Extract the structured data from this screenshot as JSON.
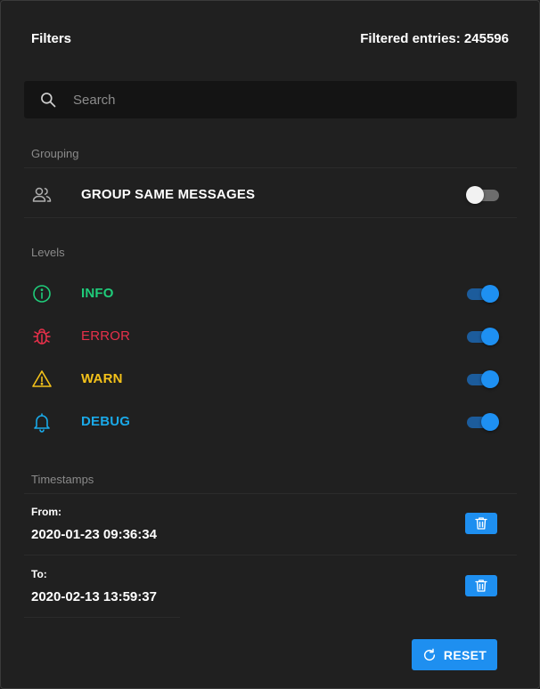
{
  "header": {
    "title": "Filters",
    "filtered_entries": "Filtered entries: 245596"
  },
  "search": {
    "placeholder": "Search",
    "value": "",
    "icon": "search-icon"
  },
  "grouping": {
    "section_label": "Grouping",
    "item": {
      "label": "GROUP SAME MESSAGES",
      "icon": "users-icon",
      "enabled": false
    }
  },
  "levels": {
    "section_label": "Levels",
    "items": [
      {
        "label": "INFO",
        "icon": "info-circle-icon",
        "color": "#1fcc7a",
        "enabled": true
      },
      {
        "label": "ERROR",
        "icon": "bug-icon",
        "color": "#e8304a",
        "enabled": true
      },
      {
        "label": "WARN",
        "icon": "warning-triangle-icon",
        "color": "#f4c21a",
        "enabled": true
      },
      {
        "label": "DEBUG",
        "icon": "bell-icon",
        "color": "#1aa9e8",
        "enabled": true
      }
    ]
  },
  "timestamps": {
    "section_label": "Timestamps",
    "from": {
      "label": "From:",
      "value": "2020-01-23 09:36:34"
    },
    "to": {
      "label": "To:",
      "value": "2020-02-13 13:59:37"
    }
  },
  "reset": {
    "label": "RESET",
    "icon": "refresh-icon"
  },
  "colors": {
    "accent": "#1e8ff0",
    "background": "#202020",
    "muted_text": "#8a8a8a"
  }
}
